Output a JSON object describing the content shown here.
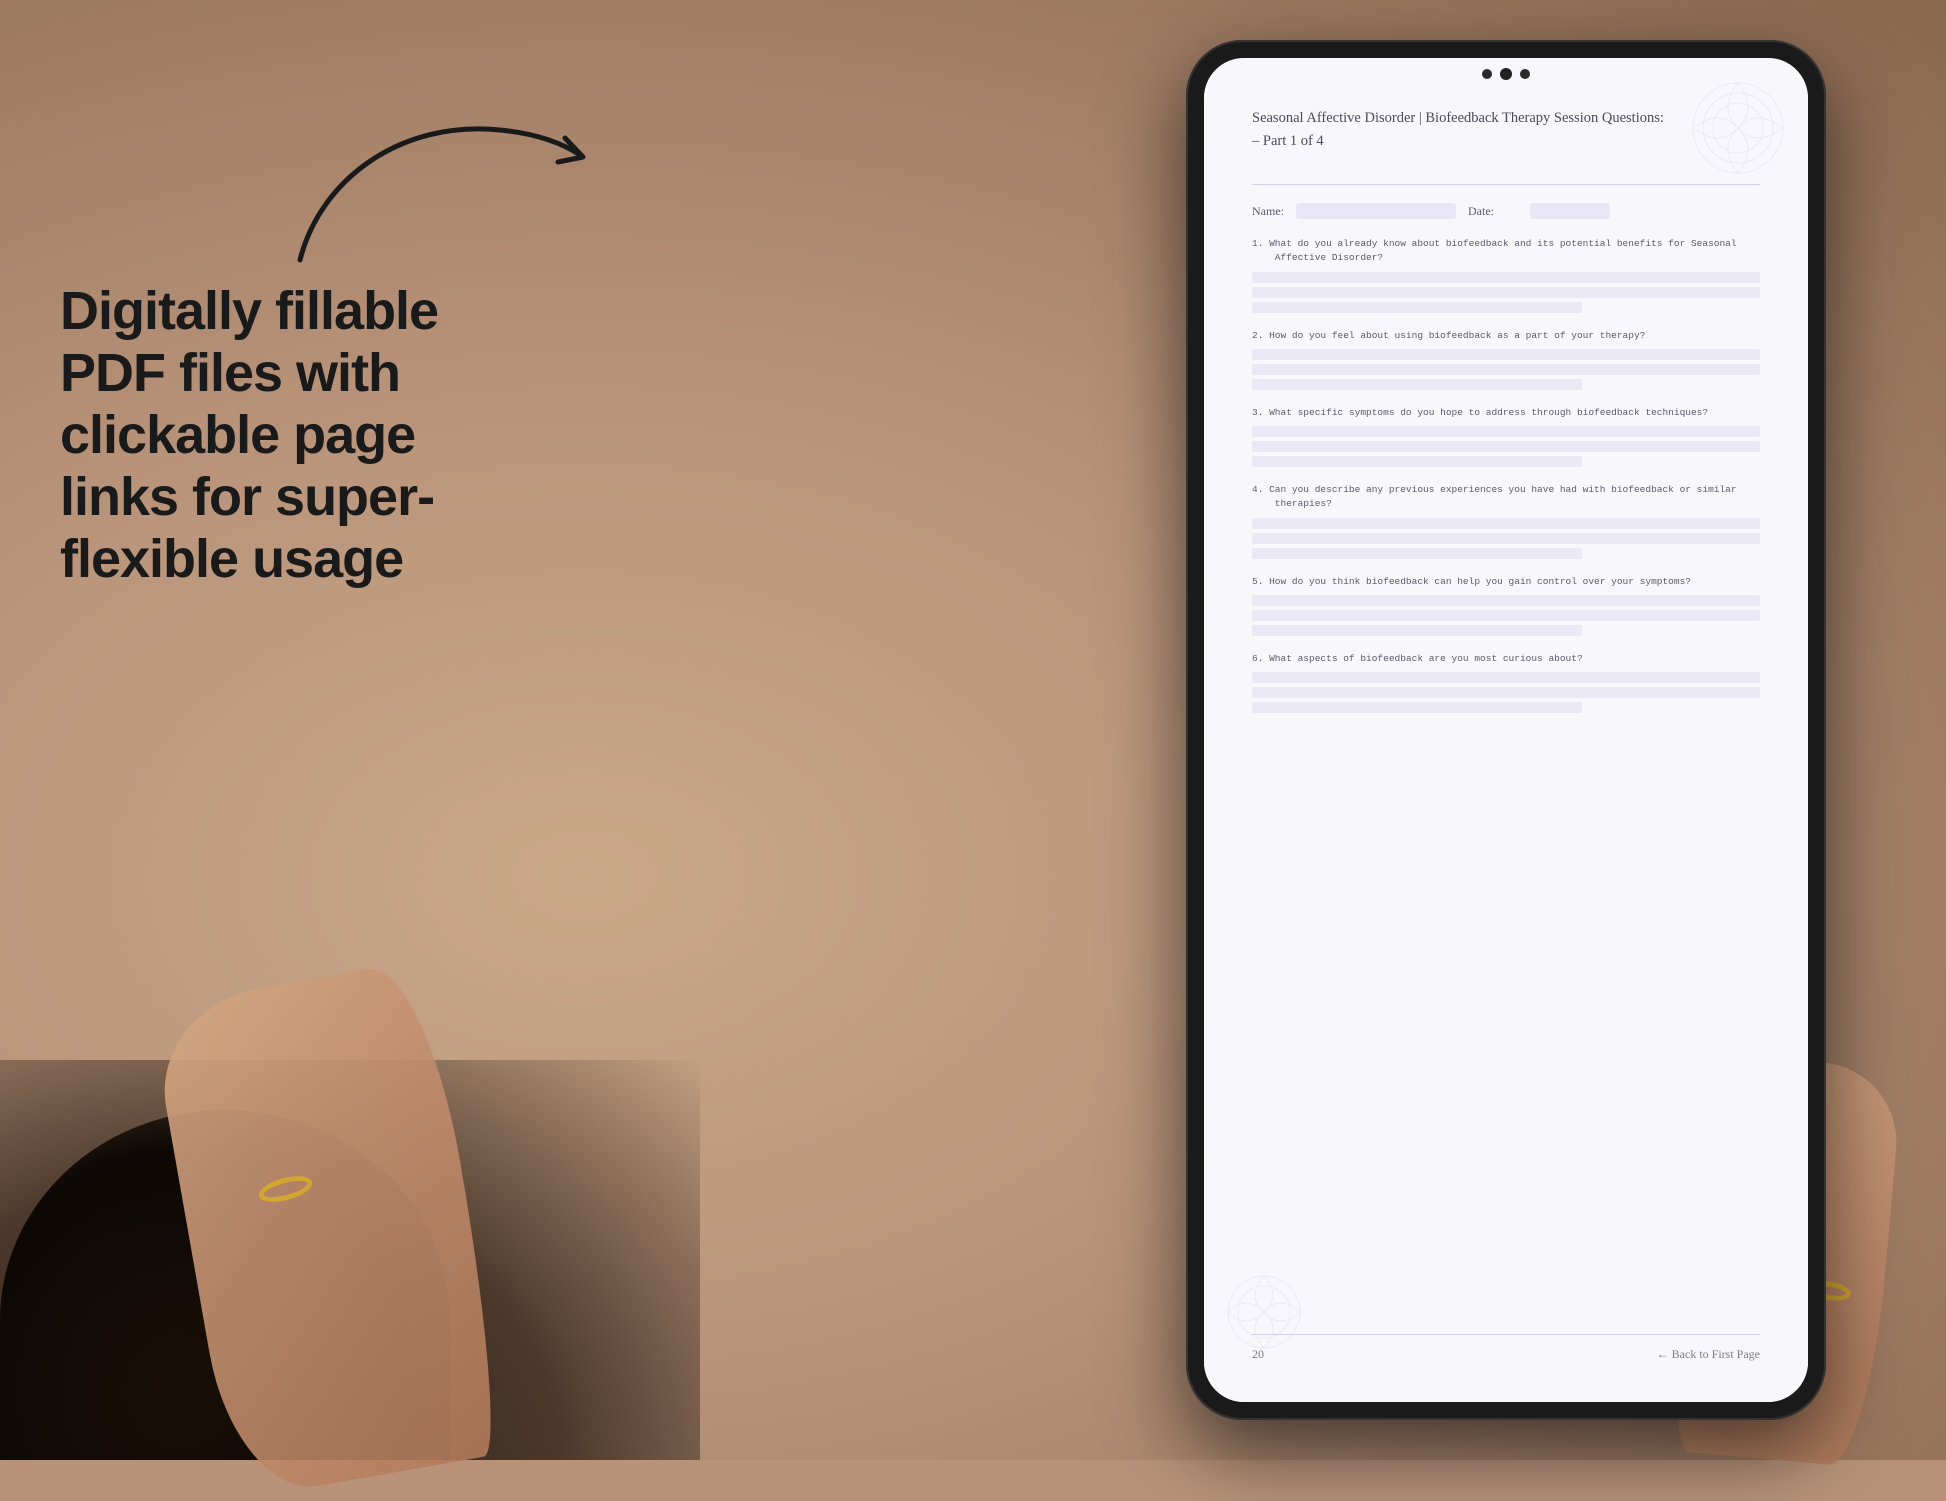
{
  "background": {
    "color": "#b8937a"
  },
  "left_text": {
    "heading": "Digitally fillable PDF files with clickable page links for super-flexible usage"
  },
  "arrow": {
    "description": "curved arrow pointing right toward tablet"
  },
  "pdf": {
    "title_line1": "Seasonal Affective Disorder | Biofeedback Therapy Session Questions:",
    "title_line2": "– Part 1 of 4",
    "name_label": "Name:",
    "date_label": "Date:",
    "questions": [
      {
        "number": "1.",
        "text": "What do you already know about biofeedback and its potential benefits for Seasonal\nAffective Disorder?",
        "answer_lines": 3
      },
      {
        "number": "2.",
        "text": "How do you feel about using biofeedback as a part of your therapy?",
        "answer_lines": 3
      },
      {
        "number": "3.",
        "text": "What specific symptoms do you hope to address through biofeedback techniques?",
        "answer_lines": 3
      },
      {
        "number": "4.",
        "text": "Can you describe any previous experiences you have had with biofeedback or similar\ntherapies?",
        "answer_lines": 3
      },
      {
        "number": "5.",
        "text": "How do you think biofeedback can help you gain control over your symptoms?",
        "answer_lines": 3
      },
      {
        "number": "6.",
        "text": "What aspects of biofeedback are you most curious about?",
        "answer_lines": 3
      }
    ],
    "footer": {
      "page_number": "20",
      "back_link": "← Back to First Page"
    }
  }
}
